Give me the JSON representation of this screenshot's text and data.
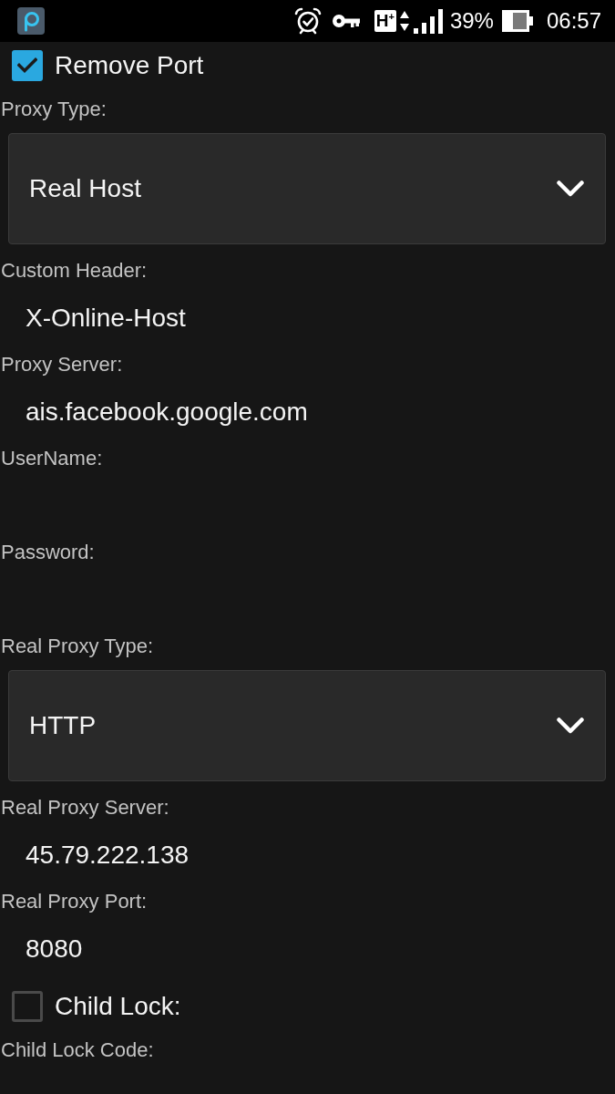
{
  "status_bar": {
    "network": "H$^{+}$",
    "battery": "39%",
    "time": "06:57"
  },
  "form": [
    {
      "kind": "checkbox",
      "label": "Remove Port",
      "checked": true
    },
    {
      "kind": "select",
      "label": "Proxy Type:",
      "value": "Real Host"
    },
    {
      "kind": "text",
      "label": "Custom Header:",
      "value": "X-Online-Host"
    },
    {
      "kind": "text",
      "label": "Proxy Server:",
      "value": "ais.facebook.google.com"
    },
    {
      "kind": "text",
      "label": "UserName:"
    },
    {
      "kind": "text",
      "label": "Password:"
    },
    {
      "kind": "select",
      "label": "Real Proxy Type:",
      "value": "HTTP"
    },
    {
      "kind": "text",
      "label": "Real Proxy Server:",
      "value": "45.79.222.138"
    },
    {
      "kind": "text",
      "label": "Real Proxy Port:",
      "value": "8080"
    },
    {
      "kind": "checkbox",
      "label": "Child Lock:",
      "checked": false
    },
    {
      "kind": "text",
      "label": "Child Lock Code:"
    }
  ]
}
